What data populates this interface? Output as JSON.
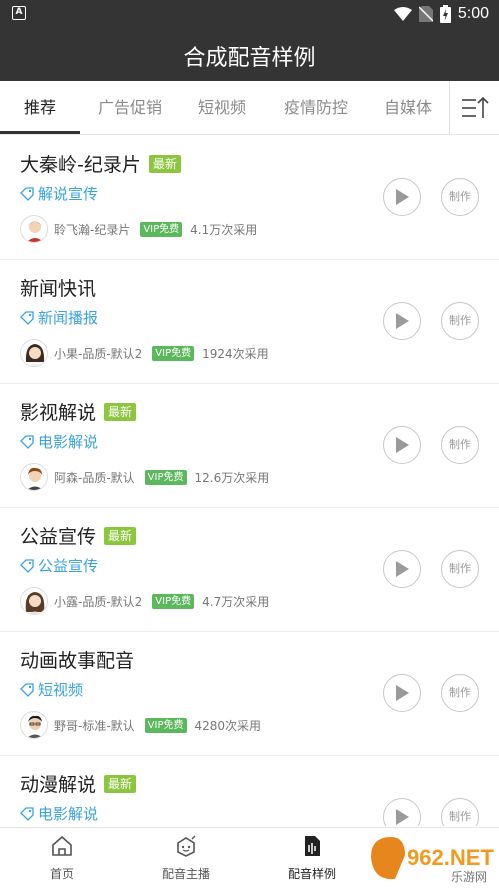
{
  "status": {
    "time": "5:00",
    "app_icon_letter": "A"
  },
  "header": {
    "title": "合成配音样例"
  },
  "tabs": [
    {
      "label": "推荐"
    },
    {
      "label": "广告促销"
    },
    {
      "label": "短视频"
    },
    {
      "label": "疫情防控"
    },
    {
      "label": "自媒体"
    }
  ],
  "labels": {
    "new_badge": "最新",
    "vip": "VIP免费",
    "make": "制作"
  },
  "items": [
    {
      "name": "大秦岭-纪录片",
      "is_new": true,
      "tag": "解说宣传",
      "voice": "聆飞瀚-纪录片",
      "uses": "4.1万次采用"
    },
    {
      "name": "新闻快讯",
      "is_new": false,
      "tag": "新闻播报",
      "voice": "小果-品质-默认2",
      "uses": "1924次采用"
    },
    {
      "name": "影视解说",
      "is_new": true,
      "tag": "电影解说",
      "voice": "阿森-品质-默认",
      "uses": "12.6万次采用"
    },
    {
      "name": "公益宣传",
      "is_new": true,
      "tag": "公益宣传",
      "voice": "小露-品质-默认2",
      "uses": "4.7万次采用"
    },
    {
      "name": "动画故事配音",
      "is_new": false,
      "tag": "短视频",
      "voice": "野哥-标准-默认",
      "uses": "4280次采用"
    },
    {
      "name": "动漫解说",
      "is_new": true,
      "tag": "电影解说",
      "voice": "",
      "uses": ""
    }
  ],
  "bottom_nav": [
    {
      "label": "首页",
      "icon": "home-icon"
    },
    {
      "label": "配音主播",
      "icon": "anchor-icon"
    },
    {
      "label": "配音样例",
      "icon": "sample-icon"
    }
  ],
  "watermark": {
    "text": "962.NET",
    "subtext": "乐游网"
  },
  "colors": {
    "header_bg": "#343434",
    "tag_blue": "#3aa3e3",
    "badge_green": "#8cc63f",
    "vip_green": "#5cb85c"
  }
}
